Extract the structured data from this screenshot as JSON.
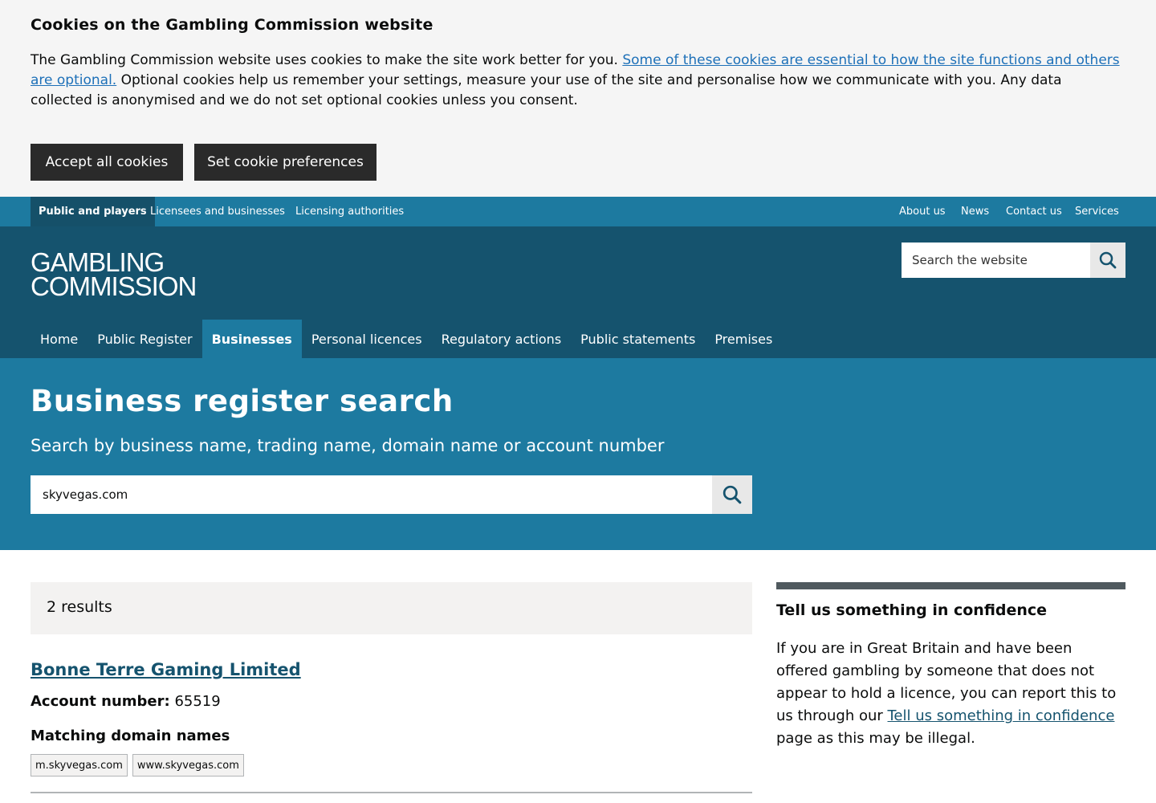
{
  "cookie_banner": {
    "title": "Cookies on the Gambling Commission website",
    "text_before_link": "The Gambling Commission website uses cookies to make the site work better for you. ",
    "link_text": "Some of these cookies are essential to how the site functions and others are optional.",
    "text_after_link": " Optional cookies help us remember your settings, measure your use of the site and personalise how we communicate with you. Any data collected is anonymised and we do not set optional cookies unless you consent.",
    "accept_label": "Accept all cookies",
    "preferences_label": "Set cookie preferences"
  },
  "audience_nav": {
    "left": [
      "Public and players",
      "Licensees and businesses",
      "Licensing authorities"
    ],
    "right": [
      "About us",
      "News",
      "Contact us",
      "Services"
    ],
    "active": "Public and players"
  },
  "header": {
    "logo_line1": "GAMBLING",
    "logo_line2": "COMMISSION",
    "search_placeholder": "Search the website"
  },
  "main_nav": {
    "items": [
      "Home",
      "Public Register",
      "Businesses",
      "Personal licences",
      "Regulatory actions",
      "Public statements",
      "Premises"
    ],
    "active": "Businesses"
  },
  "hero": {
    "title": "Business register search",
    "subtitle": "Search by business name, trading name, domain name or account number",
    "search_value": "skyvegas.com"
  },
  "results": {
    "count_text": "2 results",
    "items": [
      {
        "name": "Bonne Terre Gaming Limited",
        "account_label": "Account number:",
        "account_number": "65519",
        "domains_heading": "Matching domain names",
        "domains": [
          "m.skyvegas.com",
          "www.skyvegas.com"
        ]
      }
    ]
  },
  "sidebar": {
    "title": "Tell us something in confidence",
    "text_before_link": "If you are in Great Britain and have been offered gambling by someone that does not appear to hold a licence, you can report this to us through our ",
    "link_text": "Tell us something in confidence",
    "text_after_link": " page as this may be illegal."
  },
  "colors": {
    "audience_bar": "#1d7aa0",
    "header": "#15536e",
    "hero": "#1d7aa0",
    "link": "#1d70b8"
  }
}
